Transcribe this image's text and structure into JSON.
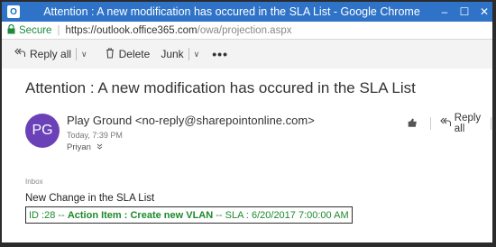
{
  "window": {
    "title": "Attention : A new modification has occured in the SLA List - Google Chrome",
    "app_icon": "O",
    "buttons": {
      "minimize": "–",
      "maximize": "☐",
      "close": "✕"
    }
  },
  "address_bar": {
    "secure_label": "Secure",
    "url_main": "https://outlook.office365.com",
    "url_path": "/owa/projection.aspx"
  },
  "toolbar": {
    "reply_all": "Reply all",
    "delete": "Delete",
    "junk": "Junk",
    "more": "•••"
  },
  "message": {
    "subject": "Attention : A new modification has occured in the SLA List",
    "avatar_initials": "PG",
    "sender": "Play Ground <no-reply@sharepointonline.com>",
    "sent_time": "Today, 7:39 PM",
    "recipient": "Priyan",
    "reply_all": "Reply all",
    "folder": "Inbox",
    "body_title": "New Change in the SLA List",
    "change": {
      "id": "ID :28",
      "sep1": " -- ",
      "action": "Action Item : Create new VLAN",
      "sep2": " -- ",
      "sla": "SLA : 6/20/2017 7:00:00 AM"
    }
  },
  "colors": {
    "titlebar": "#2f73c8",
    "avatar": "#6b41b8",
    "secure_green": "#1c8a3a",
    "body_green": "#1c8a2b"
  }
}
